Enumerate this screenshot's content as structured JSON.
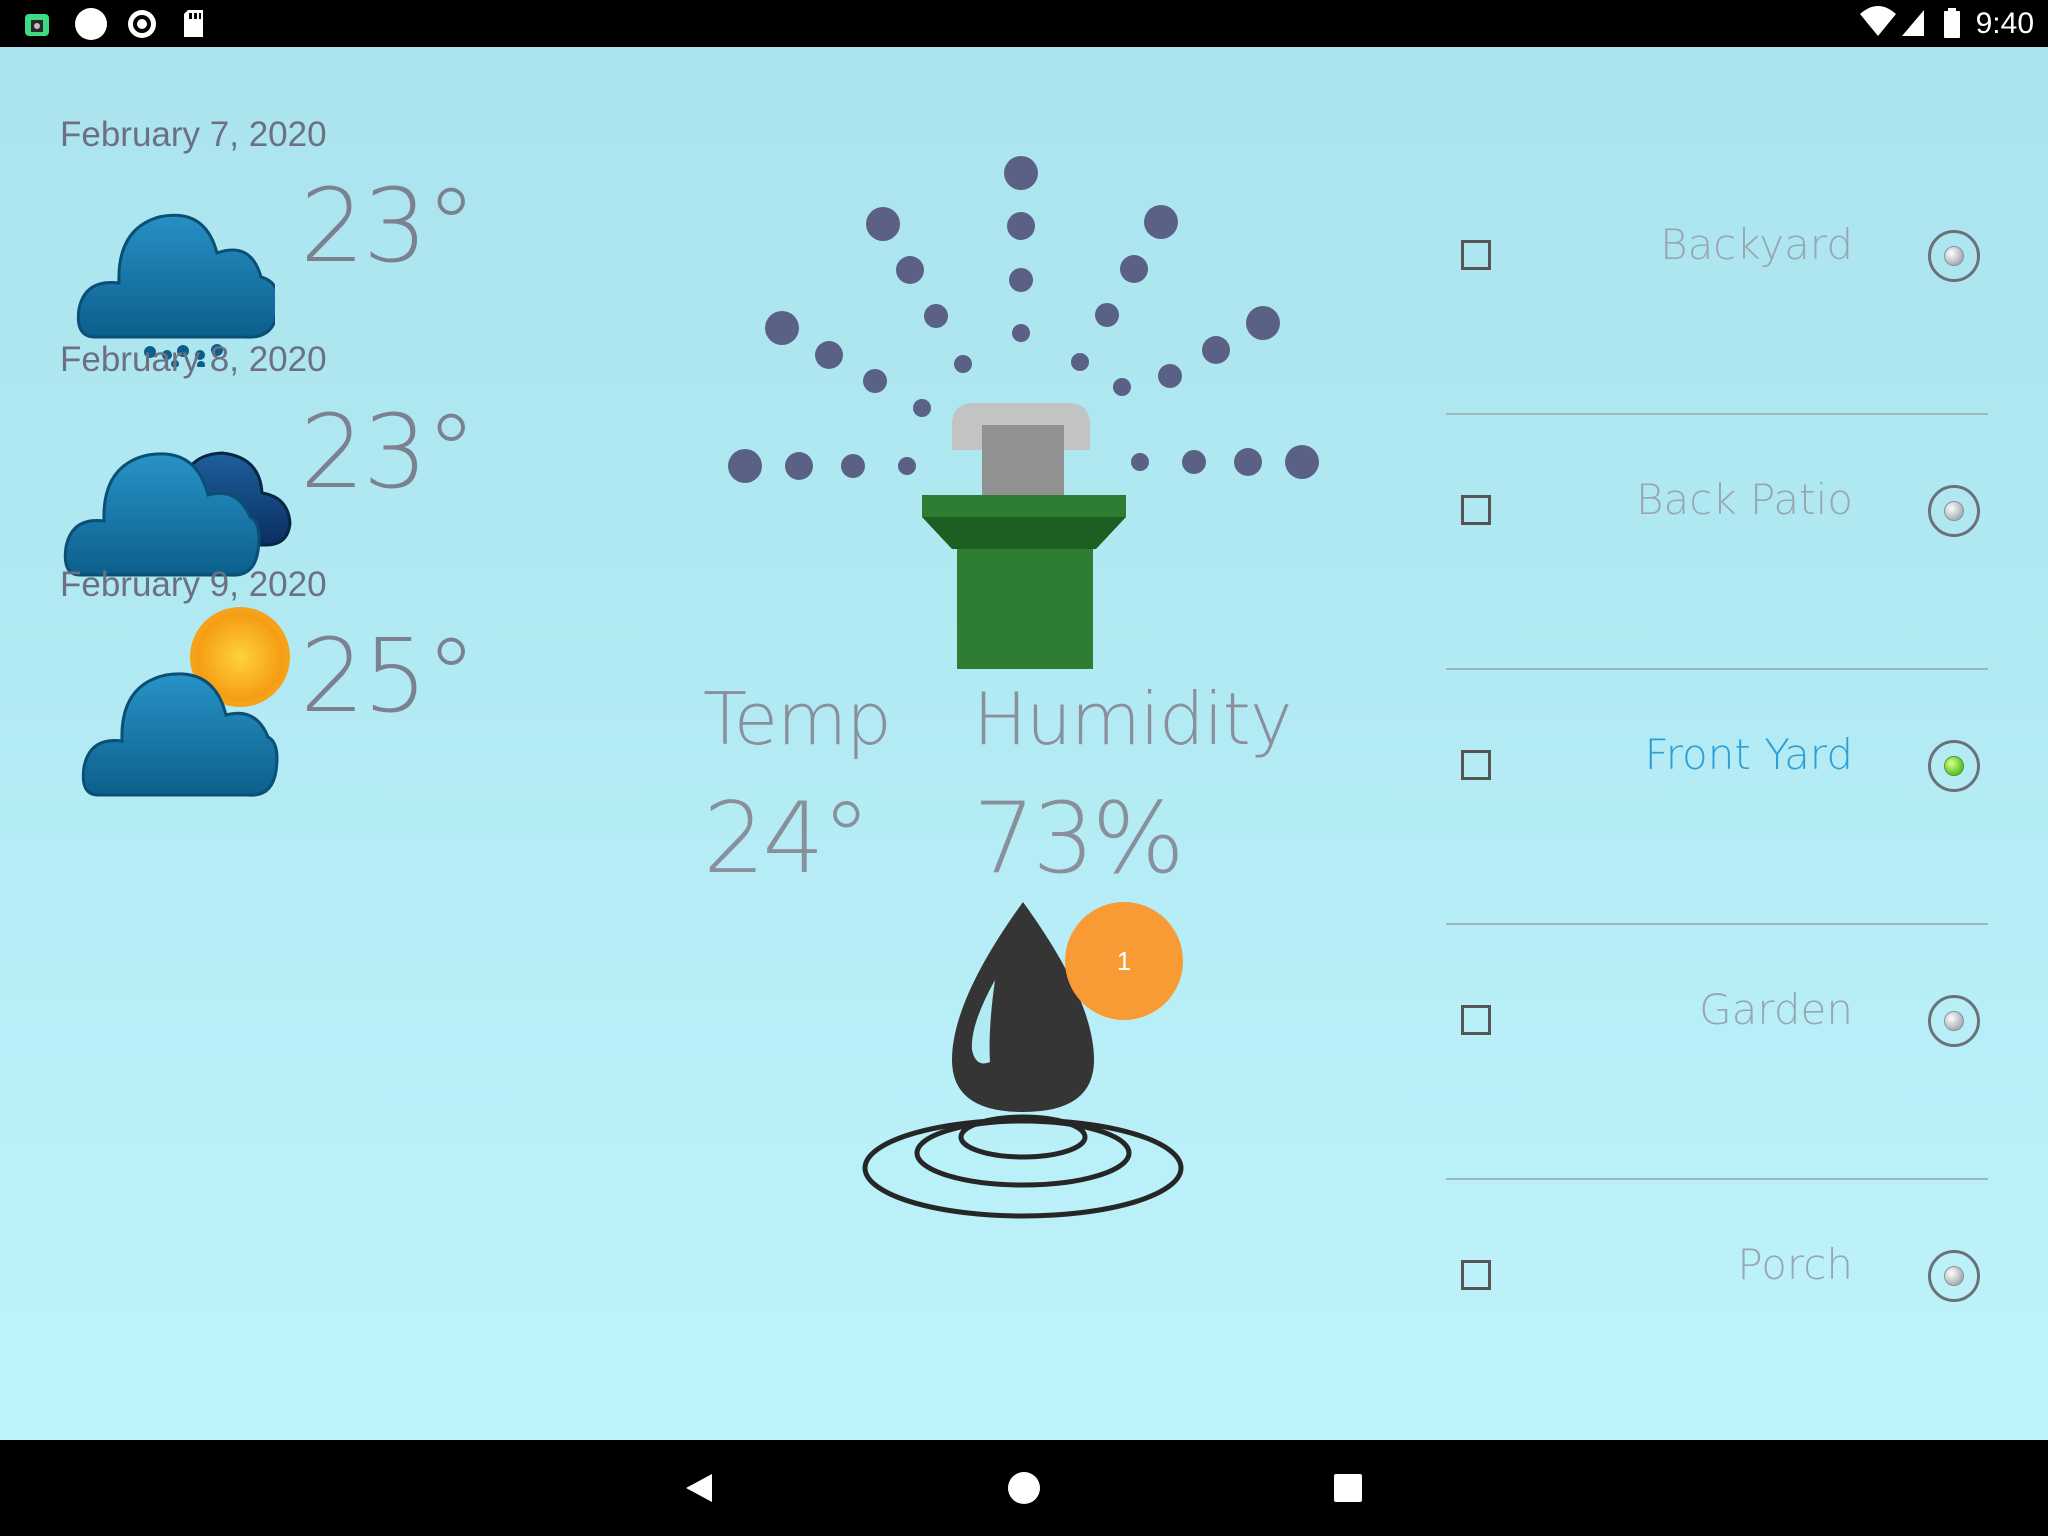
{
  "status_bar": {
    "time": "9:40",
    "left_icons": [
      "android-icon",
      "circle-notification-icon",
      "record-icon",
      "sd-card-icon"
    ],
    "right_icons": [
      "wifi-icon",
      "signal-icon",
      "battery-icon"
    ]
  },
  "forecast": [
    {
      "date": "February 7, 2020",
      "temp": "23°",
      "icon": "rain-cloud-icon"
    },
    {
      "date": "February 8, 2020",
      "temp": "23°",
      "icon": "cloudy-icon"
    },
    {
      "date": "February 9, 2020",
      "temp": "25°",
      "icon": "partly-sunny-icon"
    }
  ],
  "readings": {
    "temp_label": "Temp",
    "temp_value": "24°",
    "humidity_label": "Humidity",
    "humidity_value": "73%"
  },
  "water": {
    "icon": "water-drop-icon",
    "badge_count": "1",
    "badge_color": "#f89b35"
  },
  "sprinkler": {
    "icon": "sprinkler-icon"
  },
  "zones": [
    {
      "name": "Backyard",
      "checked": false,
      "selected": false
    },
    {
      "name": "Back Patio",
      "checked": false,
      "selected": false
    },
    {
      "name": "Front Yard",
      "checked": false,
      "selected": true
    },
    {
      "name": "Garden",
      "checked": false,
      "selected": false
    },
    {
      "name": "Porch",
      "checked": false,
      "selected": false
    }
  ],
  "colors": {
    "active_zone": "#2b9fd6",
    "selected_radio": "#5cc12a",
    "sprinkler_body": "#2e7d32",
    "spray_dots": "#5a6184"
  },
  "nav_bar": [
    "back-icon",
    "home-icon",
    "recents-icon"
  ]
}
